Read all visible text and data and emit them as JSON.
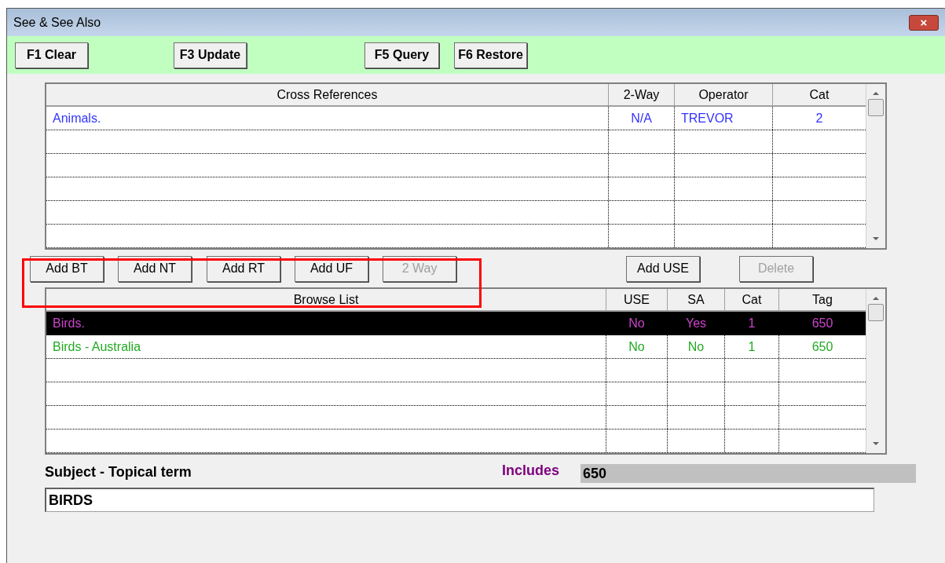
{
  "window": {
    "title": "See & See Also",
    "close": "×"
  },
  "toolbar": [
    {
      "label": "F1 Clear"
    },
    {
      "label": "F3 Update"
    },
    {
      "label": "F5 Query"
    },
    {
      "label": "F6 Restore"
    }
  ],
  "cross_references": {
    "columns": [
      "Cross References",
      "2-Way",
      "Operator",
      "Cat"
    ],
    "rows": [
      {
        "cells": [
          "Animals.",
          "N/A",
          "TREVOR",
          "2"
        ],
        "color": "#3333ff",
        "selected": false
      }
    ]
  },
  "actions": [
    {
      "label": "Add BT",
      "disabled": false
    },
    {
      "label": "Add NT",
      "disabled": false
    },
    {
      "label": "Add RT",
      "disabled": false
    },
    {
      "label": "Add UF",
      "disabled": false
    },
    {
      "label": "2 Way",
      "disabled": true
    },
    {
      "label": "Add USE",
      "disabled": false
    },
    {
      "label": "Delete",
      "disabled": true
    }
  ],
  "browse_list": {
    "columns": [
      "Browse List",
      "USE",
      "SA",
      "Cat",
      "Tag"
    ],
    "rows": [
      {
        "cells": [
          "Birds.",
          "No",
          "Yes",
          "1",
          "650"
        ],
        "color": "#cc44cc",
        "selected": true
      },
      {
        "cells": [
          "Birds - Australia",
          "No",
          "No",
          "1",
          "650"
        ],
        "color": "#22aa22",
        "selected": false
      }
    ]
  },
  "subject": {
    "label": "Subject - Topical term",
    "value": "BIRDS"
  },
  "includes": {
    "label": "Includes",
    "value": "650"
  }
}
